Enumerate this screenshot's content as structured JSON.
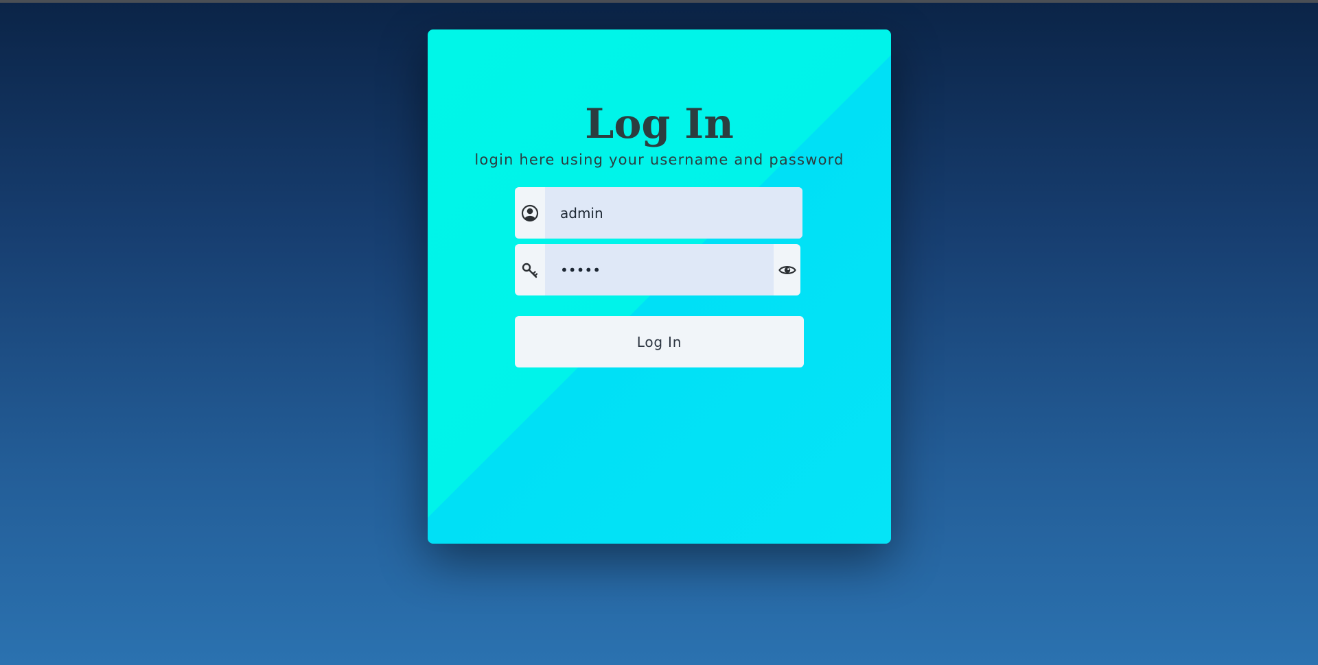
{
  "colors": {
    "card_light": "#00f6e8",
    "card_dark": "#05e4f7",
    "field_bg": "#dfe8f7",
    "text_dark": "#2c3d3f"
  },
  "login": {
    "title": "Log In",
    "subtitle": "login here using your username and password",
    "username": {
      "value": "admin",
      "icon": "user-circle-icon"
    },
    "password": {
      "value": "admin",
      "icon": "key-icon",
      "toggle_icon": "eye-icon"
    },
    "button_label": "Log In"
  }
}
